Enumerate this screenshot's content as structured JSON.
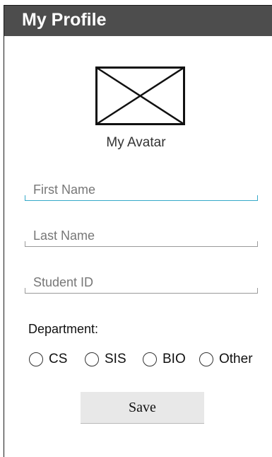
{
  "header": {
    "title": "My Profile"
  },
  "avatar": {
    "label": "My Avatar",
    "icon": "image-placeholder-icon"
  },
  "form": {
    "first_name": {
      "placeholder": "First Name",
      "value": ""
    },
    "last_name": {
      "placeholder": "Last Name",
      "value": ""
    },
    "student_id": {
      "placeholder": "Student ID",
      "value": ""
    },
    "department_label": "Department:",
    "departments": [
      "CS",
      "SIS",
      "BIO",
      "Other"
    ],
    "save_label": "Save"
  },
  "colors": {
    "header_bg": "#4d4d4d",
    "focus_accent": "#35a9c9",
    "button_bg": "#e8e8e8"
  }
}
